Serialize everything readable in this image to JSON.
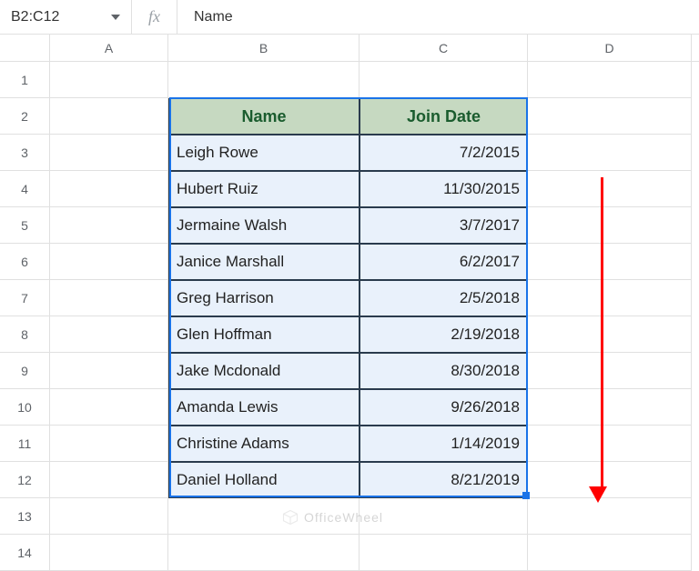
{
  "nameBox": "B2:C12",
  "formula": "Name",
  "columns": [
    "A",
    "B",
    "C",
    "D"
  ],
  "rowNumbers": [
    "1",
    "2",
    "3",
    "4",
    "5",
    "6",
    "7",
    "8",
    "9",
    "10",
    "11",
    "12",
    "13",
    "14"
  ],
  "table": {
    "headers": {
      "name": "Name",
      "join": "Join Date"
    },
    "rows": [
      {
        "name": "Leigh Rowe",
        "join": "7/2/2015"
      },
      {
        "name": "Hubert Ruiz",
        "join": "11/30/2015"
      },
      {
        "name": "Jermaine Walsh",
        "join": "3/7/2017"
      },
      {
        "name": "Janice Marshall",
        "join": "6/2/2017"
      },
      {
        "name": "Greg Harrison",
        "join": "2/5/2018"
      },
      {
        "name": "Glen Hoffman",
        "join": "2/19/2018"
      },
      {
        "name": "Jake Mcdonald",
        "join": "8/30/2018"
      },
      {
        "name": "Amanda Lewis",
        "join": "9/26/2018"
      },
      {
        "name": "Christine Adams",
        "join": "1/14/2019"
      },
      {
        "name": "Daniel Holland",
        "join": "8/21/2019"
      }
    ]
  },
  "watermark": "OfficeWheel",
  "chart_data": {
    "type": "table",
    "title": "Name / Join Date",
    "columns": [
      "Name",
      "Join Date"
    ],
    "rows": [
      [
        "Leigh Rowe",
        "7/2/2015"
      ],
      [
        "Hubert Ruiz",
        "11/30/2015"
      ],
      [
        "Jermaine Walsh",
        "3/7/2017"
      ],
      [
        "Janice Marshall",
        "6/2/2017"
      ],
      [
        "Greg Harrison",
        "2/5/2018"
      ],
      [
        "Glen Hoffman",
        "2/19/2018"
      ],
      [
        "Jake Mcdonald",
        "8/30/2018"
      ],
      [
        "Amanda Lewis",
        "9/26/2018"
      ],
      [
        "Christine Adams",
        "1/14/2019"
      ],
      [
        "Daniel Holland",
        "8/21/2019"
      ]
    ]
  }
}
